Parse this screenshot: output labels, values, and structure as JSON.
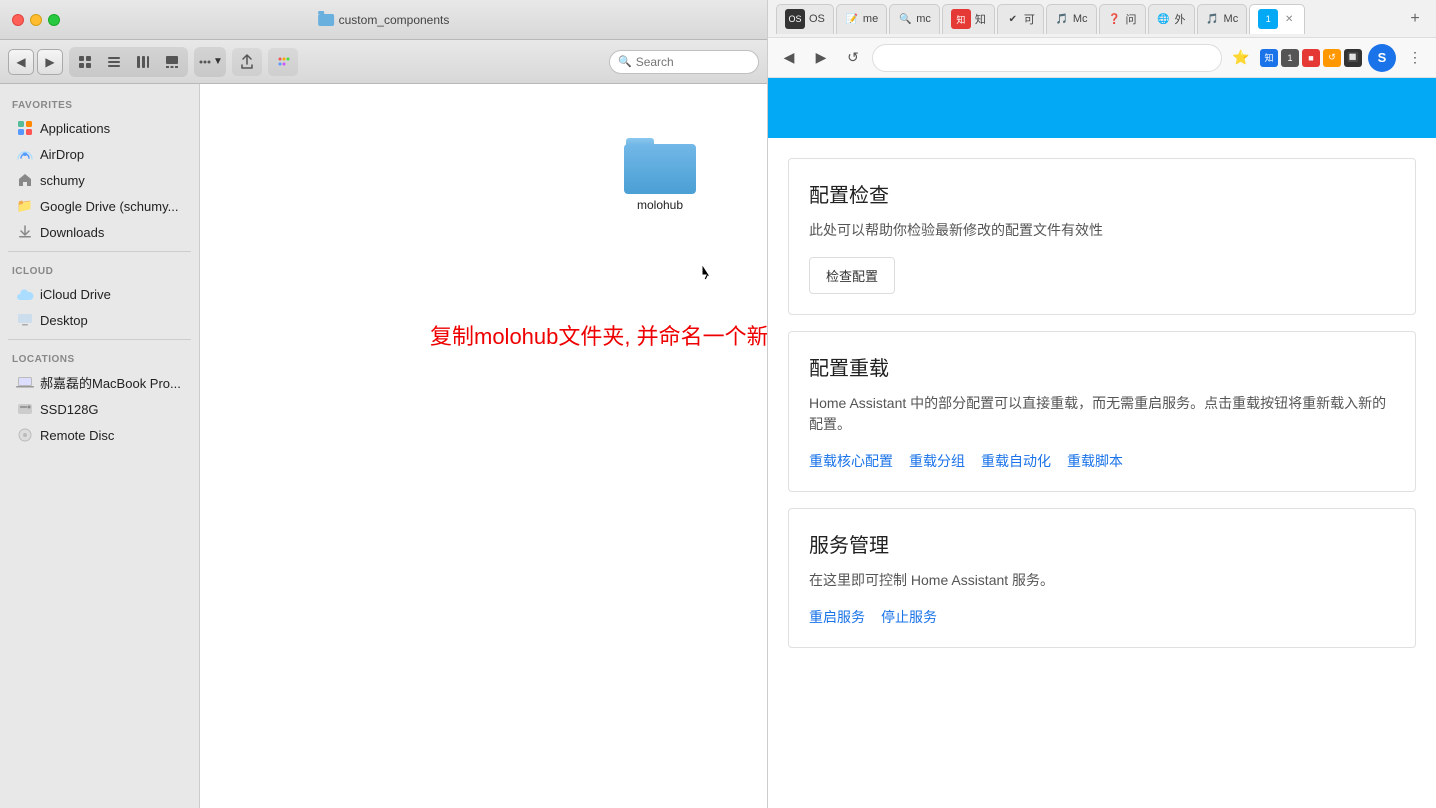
{
  "finder": {
    "title": "custom_components",
    "window_controls": {
      "close": "close",
      "minimize": "minimize",
      "maximize": "maximize"
    },
    "toolbar": {
      "view_modes": [
        "grid-view",
        "list-view",
        "column-view",
        "gallery-view"
      ],
      "action_btn": "Action",
      "share_btn": "Share",
      "tag_btn": "Tag",
      "back": "◀",
      "forward": "▶"
    },
    "search_placeholder": "Search",
    "sidebar": {
      "favorites_label": "Favorites",
      "favorites": [
        {
          "id": "applications",
          "label": "Applications",
          "icon": "🖥"
        },
        {
          "id": "airdrop",
          "label": "AirDrop",
          "icon": "📡"
        },
        {
          "id": "schumy",
          "label": "schumy",
          "icon": "🏠"
        },
        {
          "id": "google-drive",
          "label": "Google Drive (schumy...",
          "icon": "📁"
        },
        {
          "id": "downloads",
          "label": "Downloads",
          "icon": "⬇"
        }
      ],
      "icloud_label": "iCloud",
      "icloud": [
        {
          "id": "icloud-drive",
          "label": "iCloud Drive",
          "icon": "☁"
        },
        {
          "id": "desktop",
          "label": "Desktop",
          "icon": "🖥"
        }
      ],
      "locations_label": "Locations",
      "locations": [
        {
          "id": "macbook",
          "label": "郝嘉磊的MacBook Pro...",
          "icon": "💻"
        },
        {
          "id": "ssd128g",
          "label": "SSD128G",
          "icon": "💾"
        },
        {
          "id": "remote-disc",
          "label": "Remote Disc",
          "icon": "💿"
        }
      ]
    },
    "folder": {
      "name": "molohub",
      "icon_color": "#4a9fd4"
    },
    "annotation": "复制molohub文件夹, 并命名一个新的名字"
  },
  "browser": {
    "tabs": [
      {
        "id": "tab-1",
        "label": "OS",
        "favicon": "🖥",
        "active": false
      },
      {
        "id": "tab-2",
        "label": "me",
        "favicon": "📝",
        "active": false
      },
      {
        "id": "tab-3",
        "label": "mc",
        "favicon": "🔍",
        "active": false
      },
      {
        "id": "tab-4",
        "label": "知",
        "favicon": "📚",
        "active": false
      },
      {
        "id": "tab-5",
        "label": "可",
        "favicon": "✔",
        "active": false
      },
      {
        "id": "tab-6",
        "label": "Mc",
        "favicon": "🎵",
        "active": false
      },
      {
        "id": "tab-7",
        "label": "问",
        "favicon": "❓",
        "active": false
      },
      {
        "id": "tab-8",
        "label": "外",
        "favicon": "🌐",
        "active": false
      },
      {
        "id": "tab-9",
        "label": "Mc",
        "favicon": "🎵",
        "active": false
      },
      {
        "id": "tab-10",
        "label": "1",
        "favicon": "1️⃣",
        "active": true
      },
      {
        "id": "tab-close",
        "label": "✕",
        "favicon": "",
        "active": false
      }
    ],
    "add_tab": "+",
    "url": "",
    "profile_initial": "S",
    "bookmark_icon": "⭐",
    "extension_icon": "🧩",
    "more_icon": "⋮",
    "header_color": "#03a9f4",
    "sections": [
      {
        "id": "config-check",
        "title": "配置检查",
        "description": "此处可以帮助你检验最新修改的配置文件有效性",
        "action_label": "检查配置",
        "links": []
      },
      {
        "id": "config-reload",
        "title": "配置重载",
        "description": "Home Assistant 中的部分配置可以直接重载，而无需重启服务。点击重载按钮将重新载入新的配置。",
        "action_label": null,
        "links": [
          "重载核心配置",
          "重载分组",
          "重载自动化",
          "重载脚本"
        ]
      },
      {
        "id": "service-management",
        "title": "服务管理",
        "description": "在这里即可控制 Home Assistant 服务。",
        "action_label": null,
        "links": [
          "重启服务",
          "停止服务"
        ]
      }
    ]
  }
}
